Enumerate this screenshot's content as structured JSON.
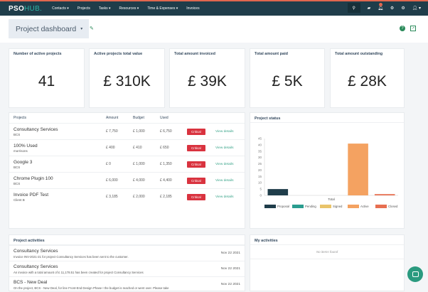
{
  "nav": {
    "logo_a": "PSO",
    "logo_b": "HUB.",
    "items": [
      "Contacts ▾",
      "Projects",
      "Tasks ▾",
      "Resources ▾",
      "Time & Expenses ▾",
      "Invoices"
    ]
  },
  "header": {
    "title": "Project dashboard",
    "caret": "▾"
  },
  "kpis": [
    {
      "label": "Number of active projects",
      "value": "41"
    },
    {
      "label": "Active projects total value",
      "value": "£ 310K"
    },
    {
      "label": "Total amount invoiced",
      "value": "£ 39K"
    },
    {
      "label": "Total amount paid",
      "value": "£ 5K"
    },
    {
      "label": "Total amount outstanding",
      "value": "£ 28K"
    }
  ],
  "projects": {
    "headers": [
      "Projects",
      "Amount",
      "Budget",
      "Used"
    ],
    "rows": [
      {
        "name": "Consultancy Services",
        "client": "BCS",
        "amount": "£ 7,750",
        "budget": "£ 1,000",
        "used": "£ 6,750",
        "status": "Critical",
        "link": "View details"
      },
      {
        "name": "100% Used",
        "client": "morrisons",
        "amount": "£ 400",
        "budget": "£ 410",
        "used": "£ 650",
        "status": "Critical",
        "link": "View details"
      },
      {
        "name": "Google 3",
        "client": "BCS",
        "amount": "£ 0",
        "budget": "£ 1,000",
        "used": "£ 1,350",
        "status": "Critical",
        "link": "View details"
      },
      {
        "name": "Chrome Plugin 100",
        "client": "BCS",
        "amount": "£ 6,000",
        "budget": "£ 4,000",
        "used": "£ 4,400",
        "status": "Critical",
        "link": "View details"
      },
      {
        "name": "Invoice PDF Test",
        "client": "Client B",
        "amount": "£ 3,185",
        "budget": "£ 2,000",
        "used": "£ 2,185",
        "status": "Critical",
        "link": "View details"
      }
    ]
  },
  "status_title": "Project status",
  "chart_data": {
    "type": "bar",
    "title": "Project status",
    "categories": [
      "Total"
    ],
    "xlabel": "",
    "ylabel": "",
    "ylim": [
      0,
      45
    ],
    "yticks": [
      0,
      5,
      10,
      15,
      20,
      25,
      30,
      35,
      40,
      45
    ],
    "legend_position": "bottom",
    "series": [
      {
        "name": "Proposal",
        "values": [
          5
        ],
        "color": "#1f3d4a"
      },
      {
        "name": "Pending",
        "values": [
          0
        ],
        "color": "#2a9d8f"
      },
      {
        "name": "Signed",
        "values": [
          0
        ],
        "color": "#e9c46a"
      },
      {
        "name": "Active",
        "values": [
          41
        ],
        "color": "#f4a261"
      },
      {
        "name": "Closed",
        "values": [
          1
        ],
        "color": "#e76f51"
      }
    ]
  },
  "activities": {
    "title": "Project activities",
    "items": [
      {
        "title": "Consultancy Services",
        "desc": "Invoice INV-2021-21 for project Consultancy Services has been sent to the customer.",
        "date": "Nov 22 2021"
      },
      {
        "title": "Consultancy Services",
        "desc": "An invoice with a total amount of £ 11,178.51 has been created for project Consultancy Services",
        "date": "Nov 22 2021"
      },
      {
        "title": "BCS - New Deal",
        "desc": "On the project, BCS - New Deal, for line Front-End Design Phase I the budget is reached or went over. Please take",
        "date": "Nov 22 2021"
      }
    ]
  },
  "my_activities": {
    "title": "My activities",
    "empty": "No items found"
  }
}
